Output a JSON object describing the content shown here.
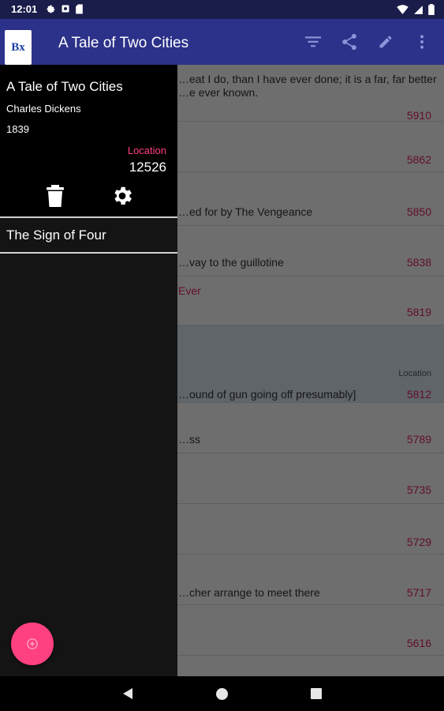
{
  "status_bar": {
    "time": "12:01",
    "icons": [
      "settings-icon",
      "media-icon",
      "sd-card-icon",
      "wifi-icon",
      "signal-icon",
      "battery-icon"
    ]
  },
  "app_bar": {
    "logo_text": "Bx",
    "title": "A Tale of Two Cities",
    "actions": [
      "filter-icon",
      "share-icon",
      "edit-icon",
      "more-vert-icon"
    ]
  },
  "entries": [
    {
      "text": "…eat I do, than I have ever done; it is a far, far better\n…e ever known.",
      "location": "5910"
    },
    {
      "text": "",
      "location": "5862"
    },
    {
      "text": "…ed for by The Vengeance",
      "location": "5850"
    },
    {
      "text": "…vay to the guillotine",
      "location": "5838"
    },
    {
      "highlight_label": "Ever",
      "text": "",
      "location": "5819"
    },
    {
      "text": "…ound of gun going off presumably]",
      "location": "5812",
      "location_label": "Location",
      "selected": true
    },
    {
      "text": "…ss",
      "location": "5789"
    },
    {
      "text": "",
      "location": "5735"
    },
    {
      "text": "",
      "location": "5729"
    },
    {
      "text": "…cher arrange to meet there",
      "location": "5717"
    },
    {
      "text": "",
      "location": "5616"
    }
  ],
  "drawer": {
    "book_title": "A Tale of Two Cities",
    "author": "Charles Dickens",
    "year": "1839",
    "location_label": "Location",
    "location_value": "12526",
    "items": [
      "The Sign of Four"
    ]
  },
  "colors": {
    "status_bar": "#1a1c4a",
    "app_bar": "#2c3189",
    "accent": "#ff4081",
    "drawer_bg": "#141414",
    "location_text": "#e0245e"
  }
}
